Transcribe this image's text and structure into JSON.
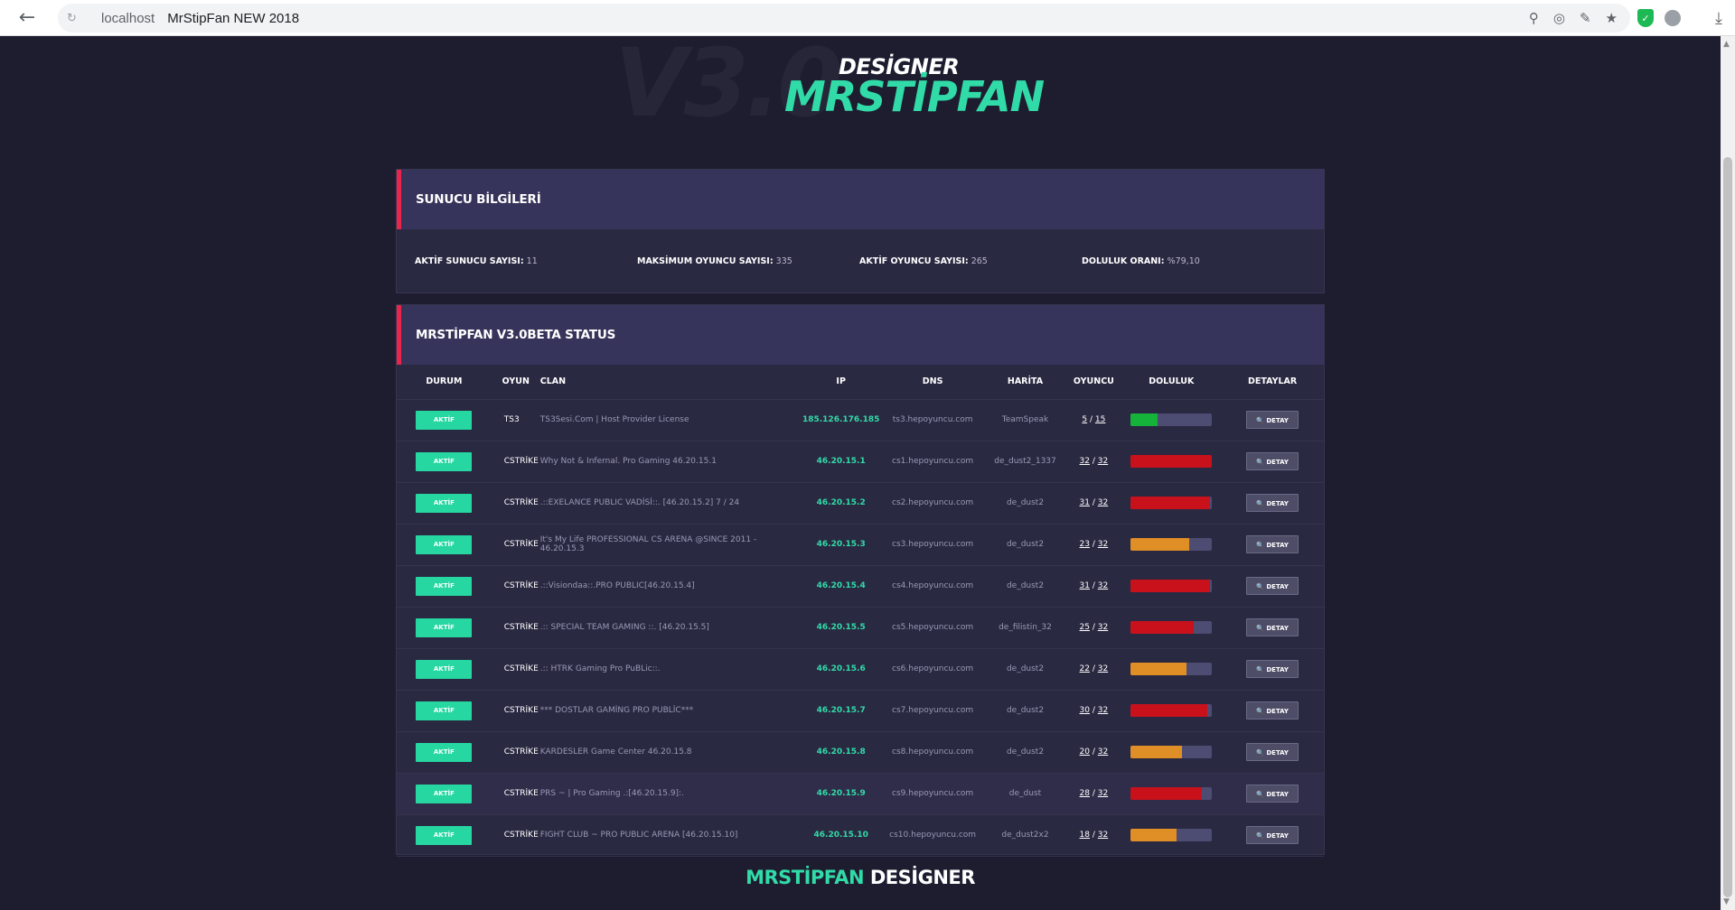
{
  "browser": {
    "host": "localhost",
    "title": "MrStipFan NEW 2018"
  },
  "logo": {
    "background_text": "V3.0",
    "designer": "DESİGNER",
    "name": "MRSTİPFAN"
  },
  "server_info": {
    "title": "SUNUCU BİLGİLERİ",
    "stats": [
      {
        "label": "AKTİF SUNUCU SAYISI:",
        "value": "11"
      },
      {
        "label": "MAKSİMUM OYUNCU SAYISI:",
        "value": "335"
      },
      {
        "label": "AKTİF OYUNCU SAYISI:",
        "value": "265"
      },
      {
        "label": "DOLULUK ORANI:",
        "value": "%79,10"
      }
    ]
  },
  "status": {
    "title": "MRSTİPFAN V3.0BETA STATUS",
    "columns": {
      "durum": "DURUM",
      "oyun": "OYUN",
      "clan": "CLAN",
      "ip": "IP",
      "dns": "DNS",
      "harita": "HARİTA",
      "oyuncu": "OYUNCU",
      "doluluk": "DOLULUK",
      "detaylar": "DETAYLAR"
    },
    "status_label": "AKTİF",
    "detail_label": "🔍 DETAY",
    "rows": [
      {
        "game": "TS3",
        "clan": "TS3Sesi.Com | Host Provider License",
        "ip": "185.126.176.185",
        "dns": "ts3.hepoyuncu.com",
        "map": "TeamSpeak",
        "players": "5",
        "max": "15",
        "fill": 0.33,
        "color": "green"
      },
      {
        "game": "CSTRİKE",
        "clan": "Why Not & Infernal. Pro Gaming 46.20.15.1",
        "ip": "46.20.15.1",
        "dns": "cs1.hepoyuncu.com",
        "map": "de_dust2_1337",
        "players": "32",
        "max": "32",
        "fill": 1.0,
        "color": "red"
      },
      {
        "game": "CSTRİKE",
        "clan": ".::EXELANCE PUBLIC VADİSİ::. [46.20.15.2] 7 / 24",
        "ip": "46.20.15.2",
        "dns": "cs2.hepoyuncu.com",
        "map": "de_dust2",
        "players": "31",
        "max": "32",
        "fill": 0.97,
        "color": "red"
      },
      {
        "game": "CSTRİKE",
        "clan": "It's My Life PROFESSIONAL CS ARENA @SINCE 2011 - 46.20.15.3",
        "ip": "46.20.15.3",
        "dns": "cs3.hepoyuncu.com",
        "map": "de_dust2",
        "players": "23",
        "max": "32",
        "fill": 0.72,
        "color": "orange"
      },
      {
        "game": "CSTRİKE",
        "clan": ".::Visiondaa::.PRO PUBLIC[46.20.15.4]",
        "ip": "46.20.15.4",
        "dns": "cs4.hepoyuncu.com",
        "map": "de_dust2",
        "players": "31",
        "max": "32",
        "fill": 0.97,
        "color": "red"
      },
      {
        "game": "CSTRİKE",
        "clan": ".:: SPECIAL TEAM GAMING ::. [46.20.15.5]",
        "ip": "46.20.15.5",
        "dns": "cs5.hepoyuncu.com",
        "map": "de_filistin_32",
        "players": "25",
        "max": "32",
        "fill": 0.78,
        "color": "red"
      },
      {
        "game": "CSTRİKE",
        "clan": ".:: HTRK Gaming Pro PuBLic::.",
        "ip": "46.20.15.6",
        "dns": "cs6.hepoyuncu.com",
        "map": "de_dust2",
        "players": "22",
        "max": "32",
        "fill": 0.69,
        "color": "orange"
      },
      {
        "game": "CSTRİKE",
        "clan": "*** DOSTLAR GAMİNG PRO PUBLİC***",
        "ip": "46.20.15.7",
        "dns": "cs7.hepoyuncu.com",
        "map": "de_dust2",
        "players": "30",
        "max": "32",
        "fill": 0.94,
        "color": "red"
      },
      {
        "game": "CSTRİKE",
        "clan": "KARDESLER Game Center 46.20.15.8",
        "ip": "46.20.15.8",
        "dns": "cs8.hepoyuncu.com",
        "map": "de_dust2",
        "players": "20",
        "max": "32",
        "fill": 0.63,
        "color": "orange"
      },
      {
        "game": "CSTRİKE",
        "clan": "PRS ~ | Pro Gaming .:[46.20.15.9]:.",
        "ip": "46.20.15.9",
        "dns": "cs9.hepoyuncu.com",
        "map": "de_dust",
        "players": "28",
        "max": "32",
        "fill": 0.88,
        "color": "red"
      },
      {
        "game": "CSTRİKE",
        "clan": "FIGHT CLUB ~ PRO PUBLIC ARENA [46.20.15.10]",
        "ip": "46.20.15.10",
        "dns": "cs10.hepoyuncu.com",
        "map": "de_dust2x2",
        "players": "18",
        "max": "32",
        "fill": 0.56,
        "color": "orange"
      }
    ]
  },
  "footer": {
    "accent": "MRSTİPFAN",
    "text": "DESİGNER"
  }
}
